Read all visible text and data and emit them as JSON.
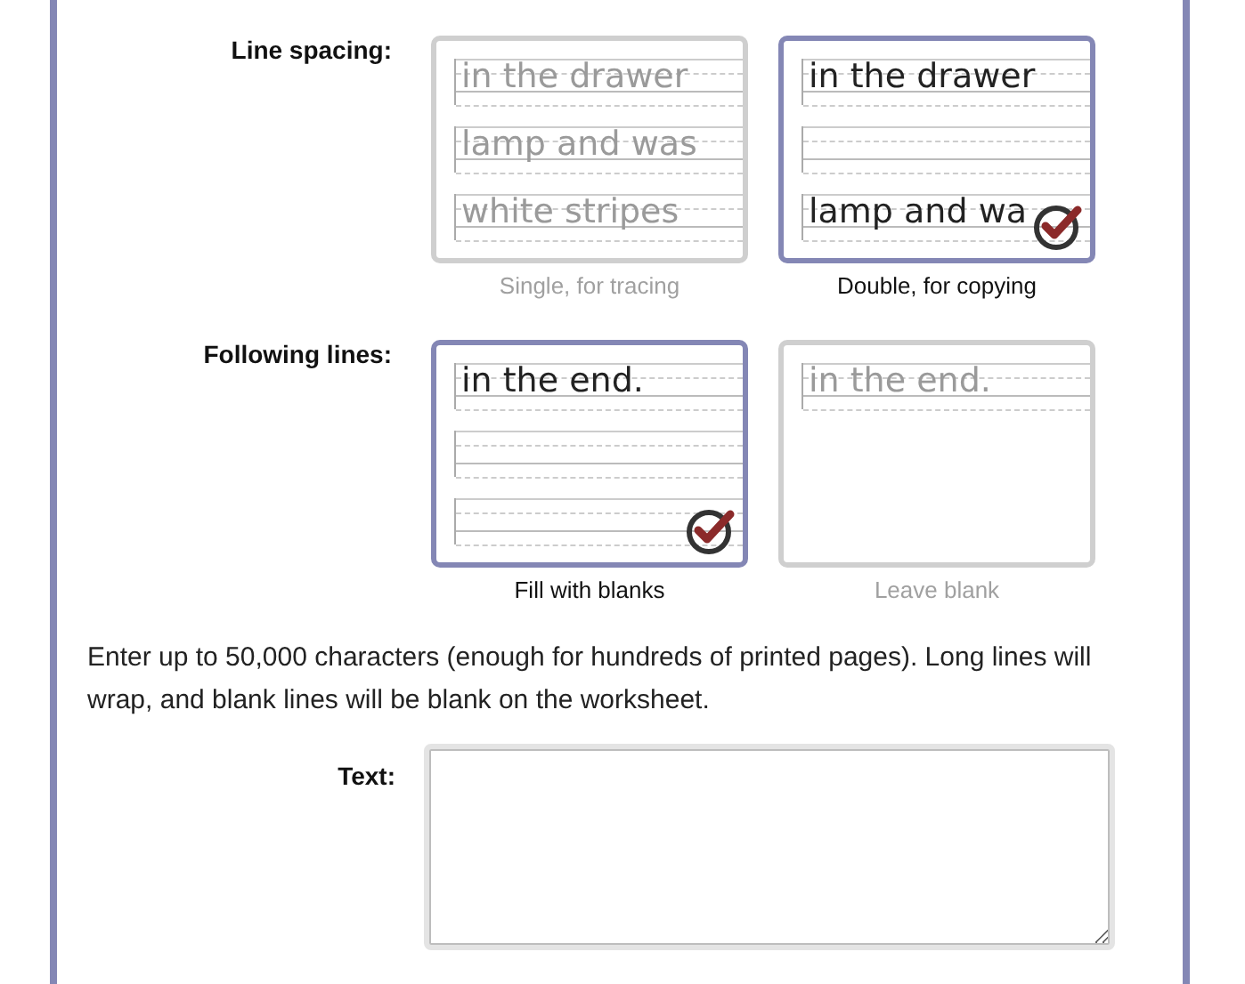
{
  "sections": [
    {
      "label": "Line spacing:",
      "options": [
        {
          "caption": "Single, for tracing",
          "selected": false,
          "rows": [
            {
              "kind": "text",
              "text": "in the drawer"
            },
            {
              "kind": "text",
              "text": "lamp and was"
            },
            {
              "kind": "text",
              "text": "white stripes"
            }
          ]
        },
        {
          "caption": "Double, for copying",
          "selected": true,
          "rows": [
            {
              "kind": "text",
              "text": "in the drawer"
            },
            {
              "kind": "blank"
            },
            {
              "kind": "text",
              "text": "lamp and wa"
            }
          ]
        }
      ]
    },
    {
      "label": "Following lines:",
      "options": [
        {
          "caption": "Fill with blanks",
          "selected": true,
          "rows": [
            {
              "kind": "text",
              "text": "in the end."
            },
            {
              "kind": "blank"
            },
            {
              "kind": "blank"
            }
          ]
        },
        {
          "caption": "Leave blank",
          "selected": false,
          "rows": [
            {
              "kind": "text",
              "text": "in the end."
            }
          ]
        }
      ]
    }
  ],
  "intro": "Enter up to 50,000 characters (enough for hundreds of printed pages). Long lines will wrap, and blank lines will be blank on the worksheet.",
  "text_field": {
    "label": "Text:"
  }
}
